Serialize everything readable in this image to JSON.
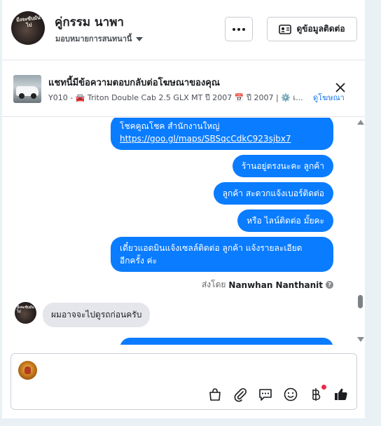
{
  "header": {
    "contact_name": "คู่กรรม นาพา",
    "assign_label": "มอบหมายการสนทนานี้",
    "avatar_text": "มีงจะขับมันไป",
    "contact_info_label": "ดูข้อมูลติดต่อ"
  },
  "ad_banner": {
    "title": "แชทนี้มีข้อความตอบกลับต่อโฆษณาของคุณ",
    "subtitle": "Y010 - 🚘 Triton Double Cab 2.5 GLX MT ปี 2007 📅 ปี 2007 | ⚙️ เ...",
    "view_ad_label": "ดูโฆษณา"
  },
  "messages": {
    "outgoing": [
      {
        "line1": "โชคคูณโชค สำนักงานใหญ่",
        "link": "https://goo.gl/maps/SBSqcCdkC923sjbx7"
      },
      {
        "text": "ร้านอยู่ตรงนะคะ  ลูกค้า"
      },
      {
        "text": "ลูกค้า  สะดวกแจ้งเบอร์ติดต่อ"
      },
      {
        "text": "หรือ ไลน์ติดต่อ มั้ยคะ"
      },
      {
        "line1": "เดี๋ยวแอดมินแจ้งเซลล์ติดต่อ ลูกค้า  แจ้งรายละเอียด",
        "line2": "อีกครั้ง ค่ะ"
      }
    ],
    "sent_by_prefix": "ส่งโดย",
    "sent_by_name": "Nanwhan Nanthanit",
    "incoming": "ผมอาจจะไปดูรถก่อนครับ"
  },
  "composer": {
    "placeholder": "",
    "tools": [
      "shopping-bag-icon",
      "paperclip-icon",
      "chat-bubble-icon",
      "emoji-icon",
      "baht-icon",
      "thumbs-up-icon"
    ]
  },
  "colors": {
    "outgoing_bubble": "#0a7cff",
    "incoming_bubble": "#e4e6eb",
    "link": "#1877f2",
    "notification_dot": "#f02849"
  }
}
